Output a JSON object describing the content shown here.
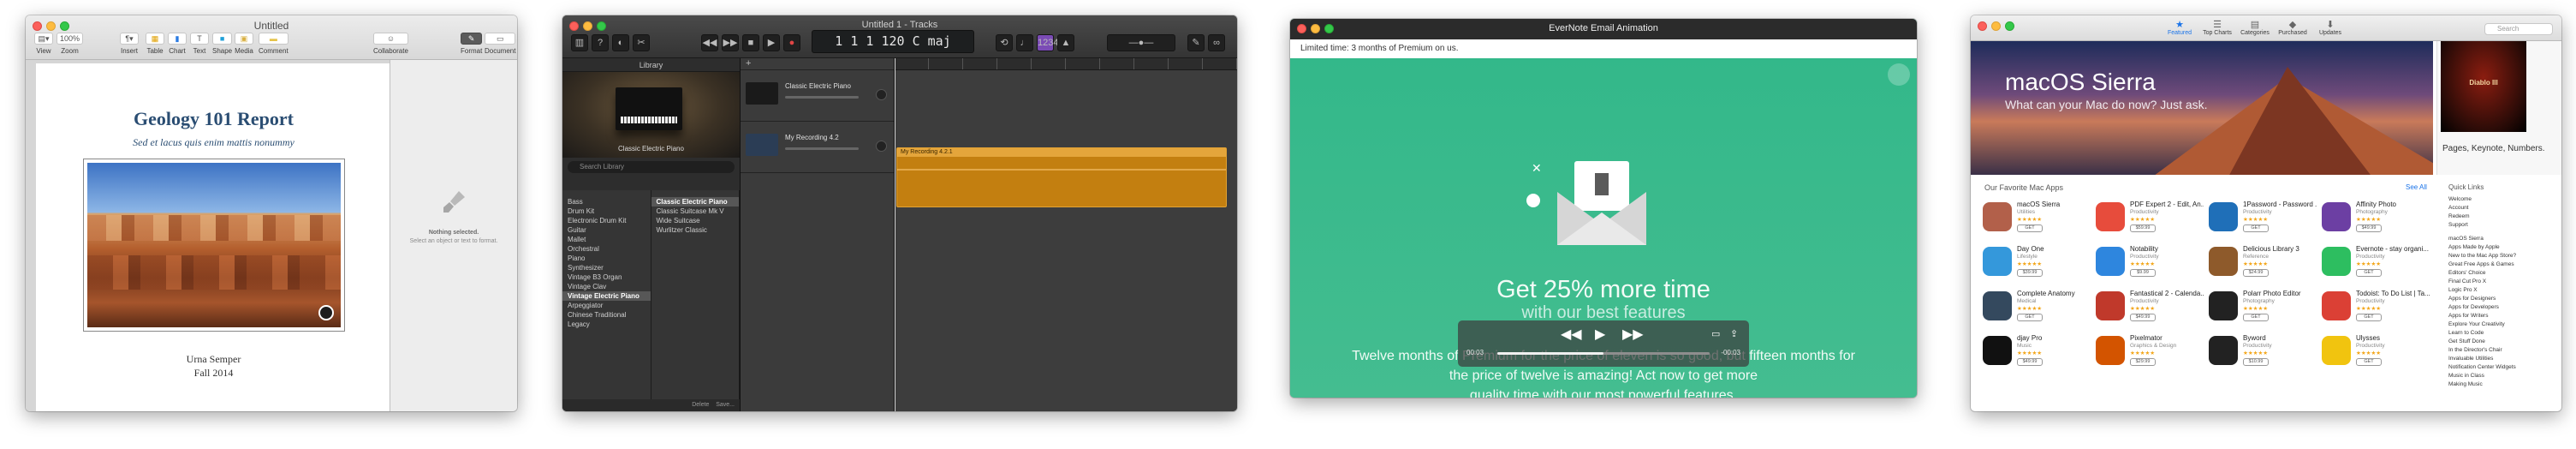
{
  "pages": {
    "title": "Untitled",
    "zoom": "100%",
    "toolbar": [
      "View",
      "Zoom",
      "Insert",
      "Table",
      "Chart",
      "Text",
      "Shape",
      "Media",
      "Comment",
      "Collaborate",
      "Format",
      "Document"
    ],
    "doc_title": "Geology 101 Report",
    "doc_subtitle": "Sed et lacus quis enim mattis nonummy",
    "author": "Urna Semper",
    "term": "Fall 2014",
    "inspector_title": "Nothing selected.",
    "inspector_hint": "Select an object or text to format."
  },
  "garageband": {
    "title": "Untitled 1 - Tracks",
    "lcd": "1 1 1 120 C maj",
    "library_header": "Library",
    "instrument": "Classic Electric Piano",
    "search": "Search Library",
    "categories": [
      "Bass",
      "Drum Kit",
      "Electronic Drum Kit",
      "Guitar",
      "Mallet",
      "Orchestral",
      "Piano",
      "Synthesizer",
      "Vintage B3 Organ",
      "Vintage Clav",
      "Vintage Electric Piano",
      "Arpeggiator",
      "Chinese Traditional",
      "Legacy"
    ],
    "selected_category": "Vintage Electric Piano",
    "patches": [
      "Classic Electric Piano",
      "Classic Suitcase Mk V",
      "Wide Suitcase",
      "Wurlitzer Classic"
    ],
    "selected_patch": "Classic Electric Piano",
    "footer": [
      "Delete",
      "Save..."
    ],
    "tracks": [
      {
        "name": "Classic Electric Piano"
      },
      {
        "name": "My Recording 4.2"
      }
    ],
    "region_label": "My Recording 4.2.1"
  },
  "evernote": {
    "title": "EverNote Email Animation",
    "banner": "Limited time: 3 months of Premium on us.",
    "headline": "Get 25% more time",
    "headline2": "with our best features",
    "body_line1": "Twelve months of Premium for the price of eleven is so good, but fifteen months for",
    "body_line2": "the price of twelve is amazing! Act now to get more",
    "body_line3": "quality time with our most powerful features.",
    "time_elapsed": "00:03",
    "time_remaining": "-00:03",
    "progress_fraction": 0.5
  },
  "appstore": {
    "tabs": [
      "Featured",
      "Top Charts",
      "Categories",
      "Purchased",
      "Updates"
    ],
    "search_placeholder": "Search",
    "hero_title": "macOS Sierra",
    "hero_tagline": "What can your Mac do now? Just ask.",
    "promo_game": "Diablo III",
    "promo_text": "Pages, Keynote, Numbers.",
    "section": "Our Favorite Mac Apps",
    "see_all": "See All",
    "apps": [
      {
        "name": "macOS Sierra",
        "cat": "Utilities",
        "btn": "GET",
        "color": "#b2604a"
      },
      {
        "name": "PDF Expert 2 - Edit, An...",
        "cat": "Productivity",
        "btn": "$59.99",
        "color": "#e74c3c"
      },
      {
        "name": "1Password - Password ...",
        "cat": "Productivity",
        "btn": "GET",
        "color": "#1f6fb8"
      },
      {
        "name": "Affinity Photo",
        "cat": "Photography",
        "btn": "$49.99",
        "color": "#6c3fa3"
      },
      {
        "name": "Day One",
        "cat": "Lifestyle",
        "btn": "$39.99",
        "color": "#3498db"
      },
      {
        "name": "Notability",
        "cat": "Productivity",
        "btn": "$9.99",
        "color": "#2e86de"
      },
      {
        "name": "Delicious Library 3",
        "cat": "Reference",
        "btn": "$24.99",
        "color": "#8e5a2b"
      },
      {
        "name": "Evernote - stay organi...",
        "cat": "Productivity",
        "btn": "GET",
        "color": "#2dbe60"
      },
      {
        "name": "Complete Anatomy",
        "cat": "Medical",
        "btn": "GET",
        "color": "#34495e"
      },
      {
        "name": "Fantastical 2 - Calenda...",
        "cat": "Productivity",
        "btn": "$49.99",
        "color": "#c0392b"
      },
      {
        "name": "Polarr Photo Editor",
        "cat": "Photography",
        "btn": "GET",
        "color": "#222222"
      },
      {
        "name": "Todoist: To Do List | Ta...",
        "cat": "Productivity",
        "btn": "GET",
        "color": "#db4035"
      },
      {
        "name": "djay Pro",
        "cat": "Music",
        "btn": "$49.99",
        "color": "#111111"
      },
      {
        "name": "Pixelmator",
        "cat": "Graphics & Design",
        "btn": "$29.99",
        "color": "#d35400"
      },
      {
        "name": "Byword",
        "cat": "Productivity",
        "btn": "$10.99",
        "color": "#222222"
      },
      {
        "name": "Ulysses",
        "cat": "Productivity",
        "btn": "GET",
        "color": "#f1c40f"
      }
    ],
    "quick_links_header": "Quick Links",
    "quick_links": [
      "Welcome",
      "Account",
      "Redeem",
      "Support",
      "",
      "macOS Sierra",
      "Apps Made by Apple",
      "New to the Mac App Store?",
      "Great Free Apps & Games",
      "Editors' Choice",
      "Final Cut Pro X",
      "Logic Pro X",
      "Apps for Designers",
      "Apps for Developers",
      "Apps for Writers",
      "Explore Your Creativity",
      "Learn to Code",
      "Get Stuff Done",
      "In the Director's Chair",
      "Invaluable Utilities",
      "Notification Center Widgets",
      "Music in Class",
      "Making Music"
    ]
  }
}
